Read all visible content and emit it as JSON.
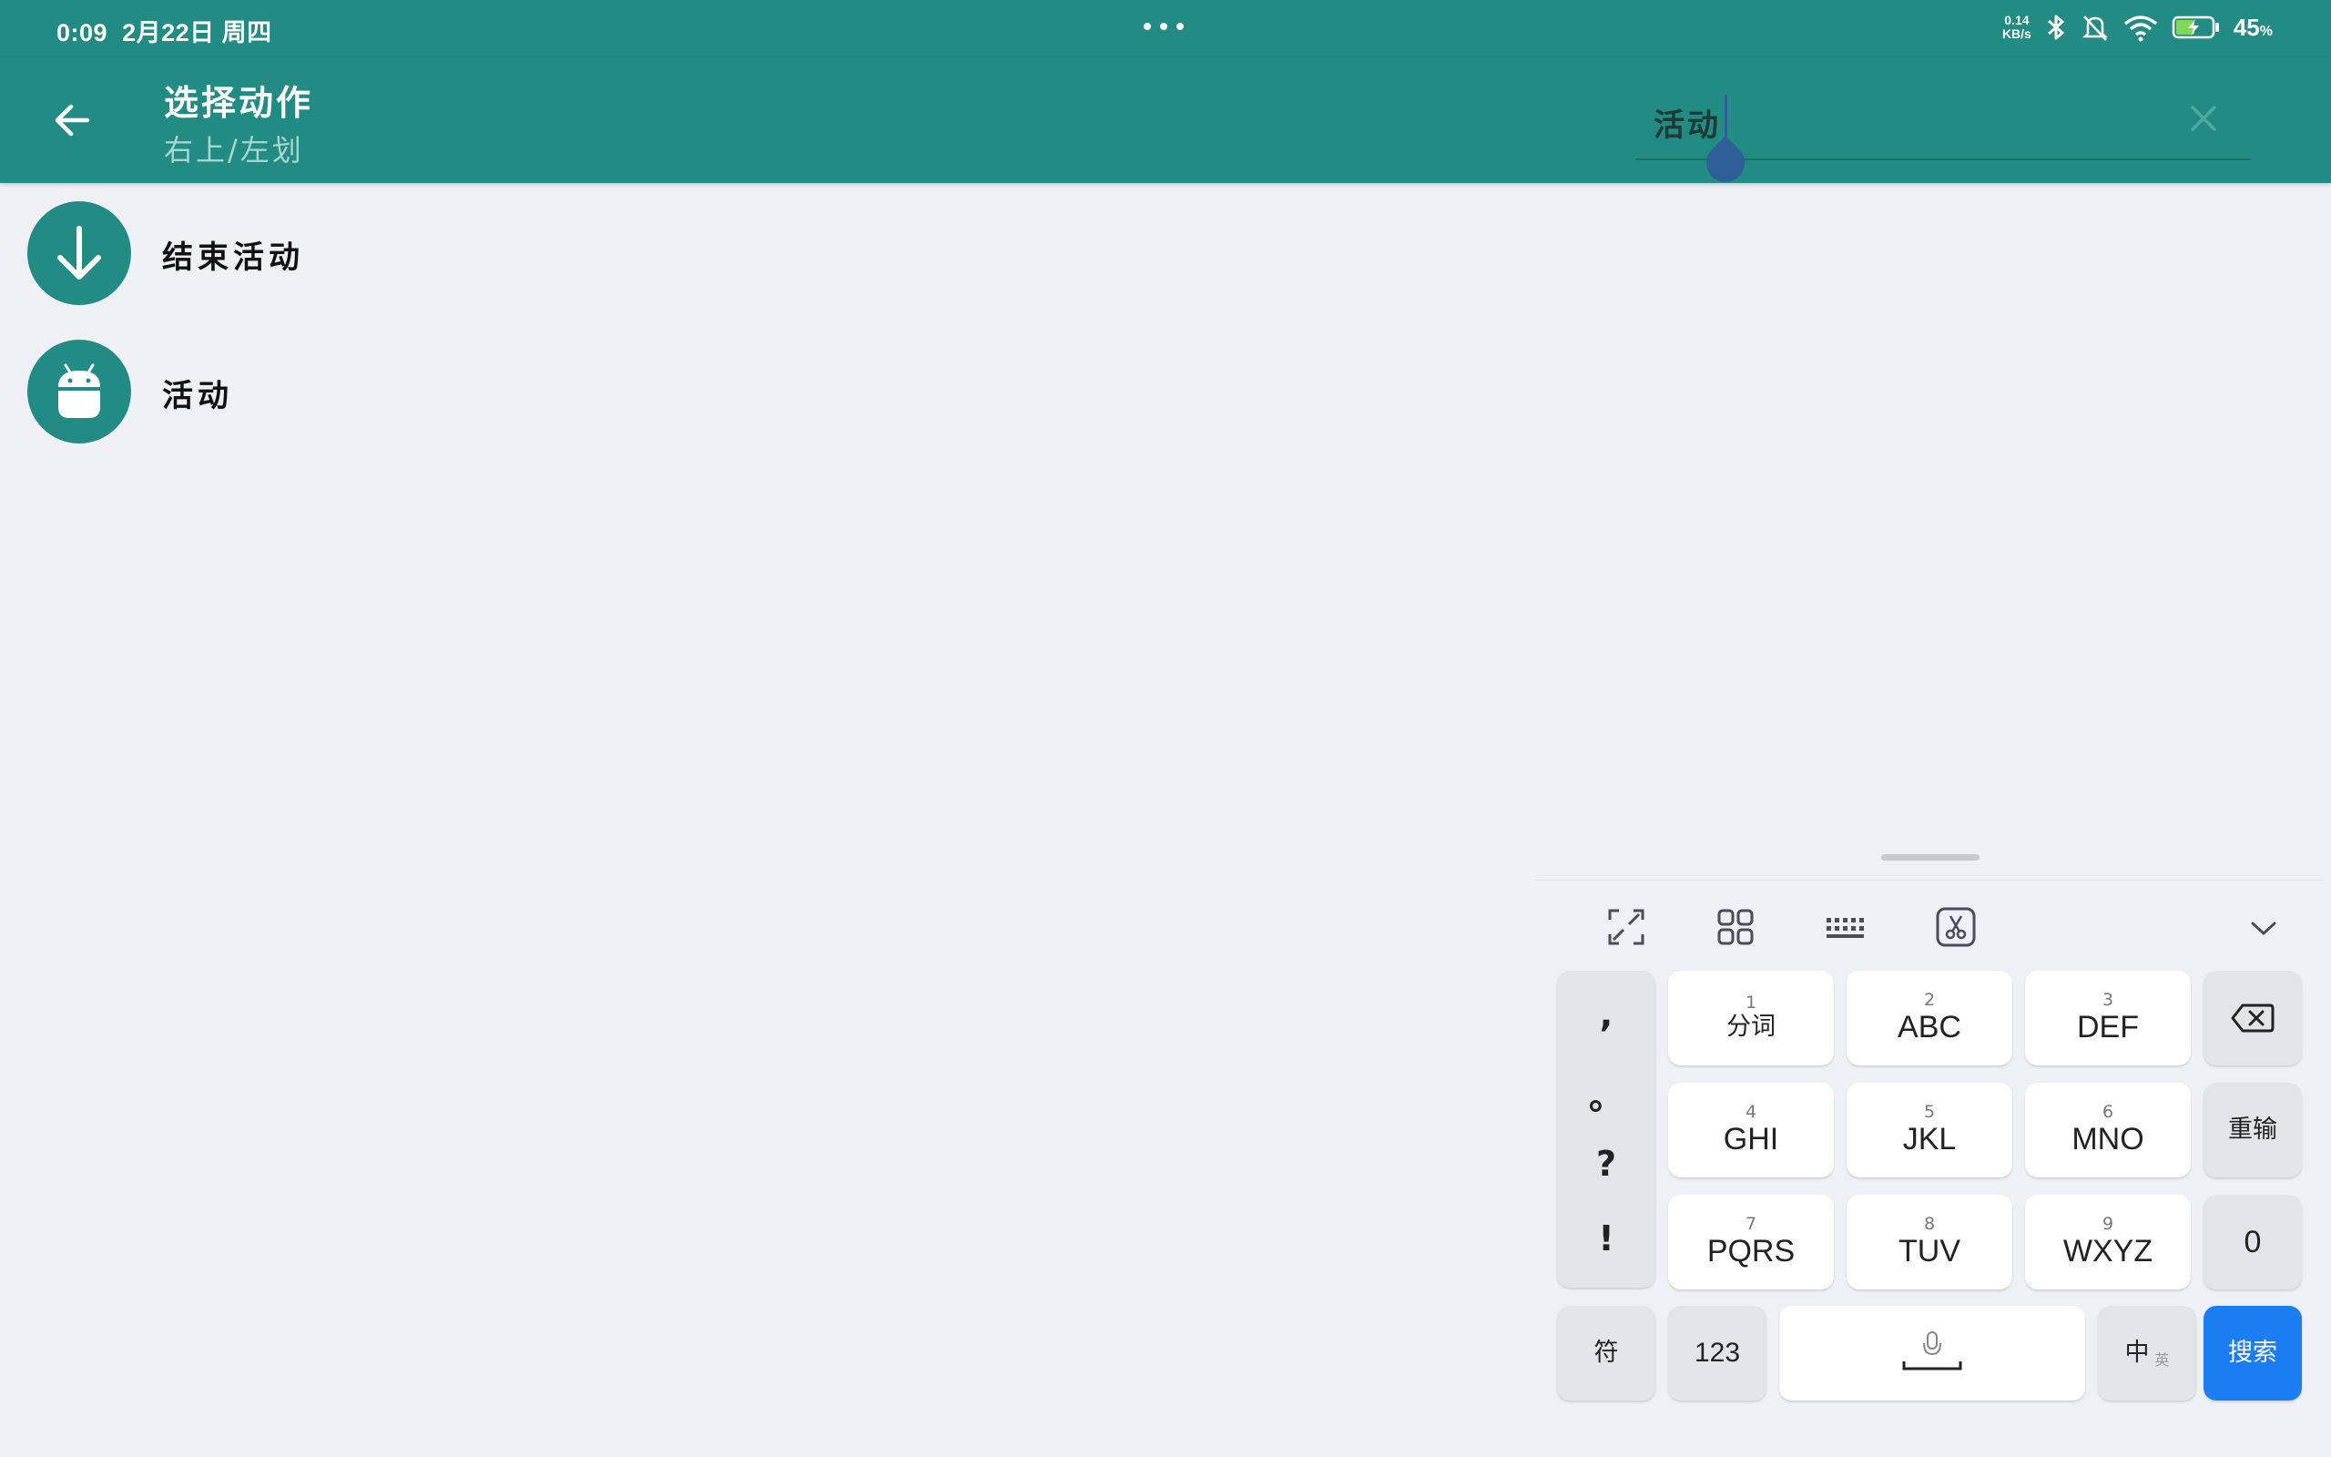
{
  "status_bar": {
    "time": "0:09",
    "date": "2月22日 周四",
    "net_speed_value": "0.14",
    "net_speed_unit": "KB/s",
    "battery_value": "45",
    "battery_unit": "%"
  },
  "app_bar": {
    "title": "选择动作",
    "subtitle": "右上/左划",
    "search_value": "活动"
  },
  "results": [
    {
      "label": "结束活动",
      "icon": "arrow-down-icon"
    },
    {
      "label": "活动",
      "icon": "android-icon"
    }
  ],
  "keyboard": {
    "punctuation": [
      ",",
      "。",
      "?",
      "!"
    ],
    "keys": {
      "k1": {
        "num": "1",
        "text": "分词"
      },
      "k2": {
        "num": "2",
        "text": "ABC"
      },
      "k3": {
        "num": "3",
        "text": "DEF"
      },
      "k4": {
        "num": "4",
        "text": "GHI"
      },
      "k5": {
        "num": "5",
        "text": "JKL"
      },
      "k6": {
        "num": "6",
        "text": "MNO"
      },
      "k7": {
        "num": "7",
        "text": "PQRS"
      },
      "k8": {
        "num": "8",
        "text": "TUV"
      },
      "k9": {
        "num": "9",
        "text": "WXYZ"
      }
    },
    "reenter": "重输",
    "zero": "0",
    "symbols": "符",
    "numbers": "123",
    "lang_main": "中",
    "lang_sub": "英",
    "search": "搜索"
  },
  "colors": {
    "primary": "#228b84",
    "accent_blue": "#1a7ef2",
    "background": "#eff0f5"
  }
}
